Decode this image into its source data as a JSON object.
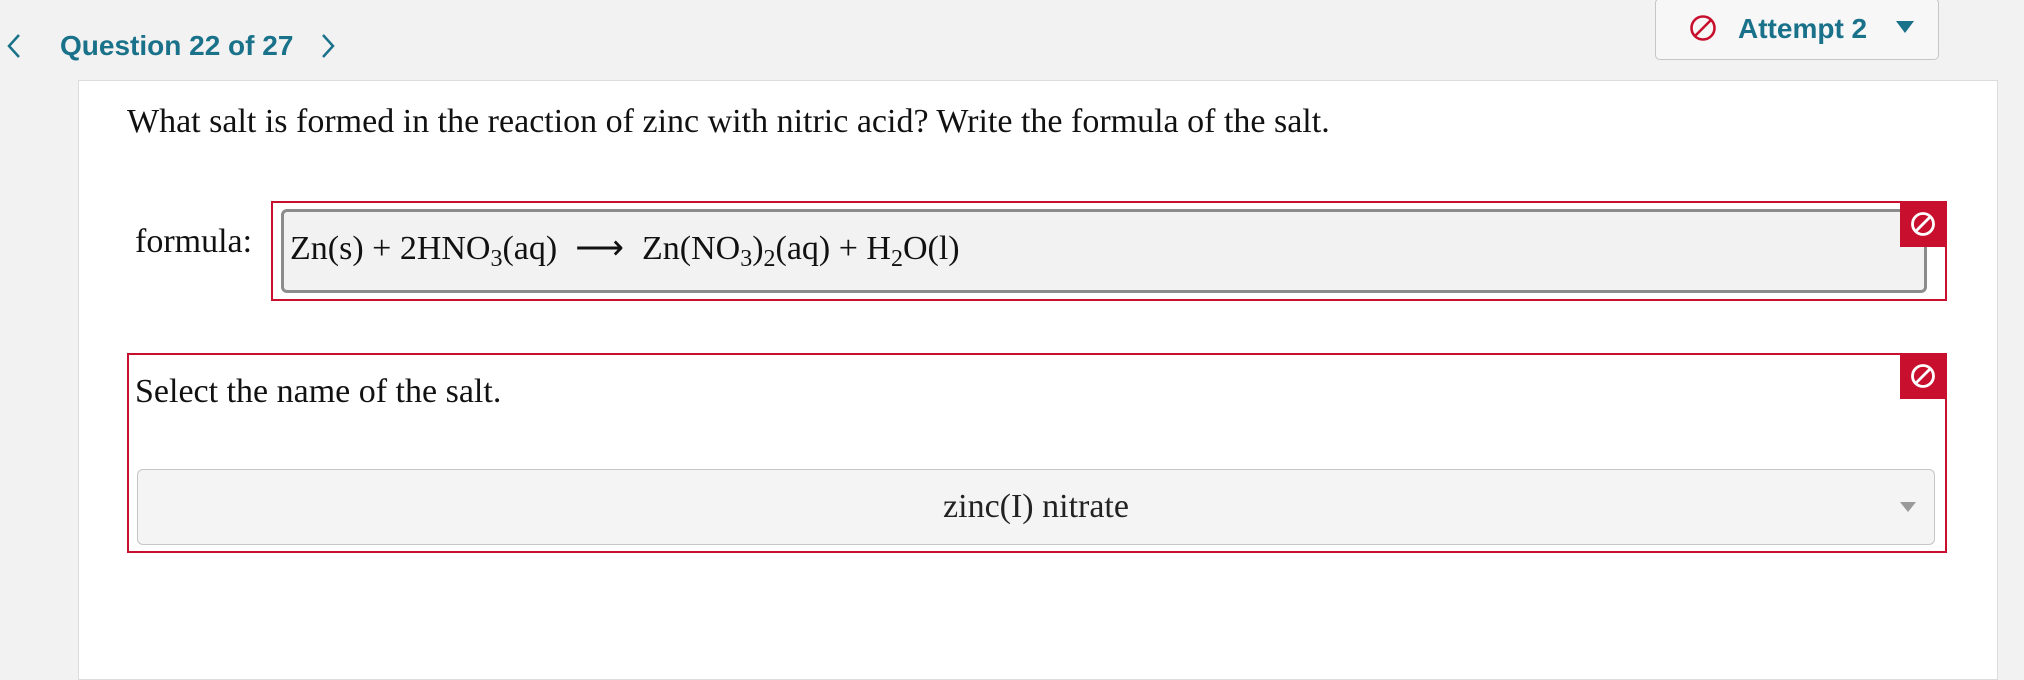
{
  "nav": {
    "question_label": "Question 22 of 27"
  },
  "attempt": {
    "label": "Attempt 2"
  },
  "question": {
    "text": "What salt is formed in the reaction of zinc with nitric acid? Write the formula of the salt."
  },
  "formula": {
    "label": "formula:",
    "reactant1": "Zn(s) + 2HNO",
    "reactant1_sub": "3",
    "reactant1_state": "(aq)",
    "arrow": "⟶",
    "product1": "Zn(NO",
    "product1_sub1": "3",
    "product1_mid": ")",
    "product1_sub2": "2",
    "product1_state": "(aq) + H",
    "product2_sub": "2",
    "product2_rest": "O(l)"
  },
  "salt_select": {
    "prompt": "Select the name of the salt.",
    "selected_value": "zinc(I) nitrate"
  },
  "colors": {
    "accent": "#19718a",
    "error": "#c8102e"
  },
  "icons": {
    "prev": "chevron-left-icon",
    "next": "chevron-right-icon",
    "attempt_status": "no-entry-icon",
    "attempt_menu": "caret-down-icon",
    "error": "no-entry-icon"
  }
}
